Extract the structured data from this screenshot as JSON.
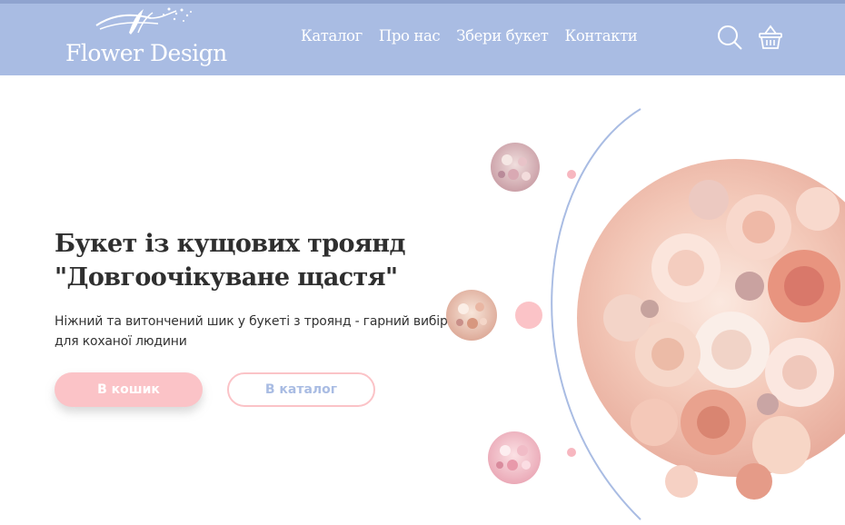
{
  "header": {
    "logo_text": "Flower Design",
    "nav": [
      "Каталог",
      "Про нас",
      "Збери букет",
      "Контакти"
    ],
    "icons": [
      "search-icon",
      "basket-icon"
    ]
  },
  "hero": {
    "title_line1": "Букет із кущових троянд",
    "title_line2": "\"Довгоочікуване щастя\"",
    "description": "Ніжний та витончений шик у букеті з троянд - гарний вибір для коханої людини",
    "cart_button": "В кошик",
    "catalog_button": "В каталог"
  },
  "colors": {
    "header_bg": "#a9bce3",
    "accent_pink": "#fbc3c7",
    "arc_blue": "#a9bce3"
  }
}
